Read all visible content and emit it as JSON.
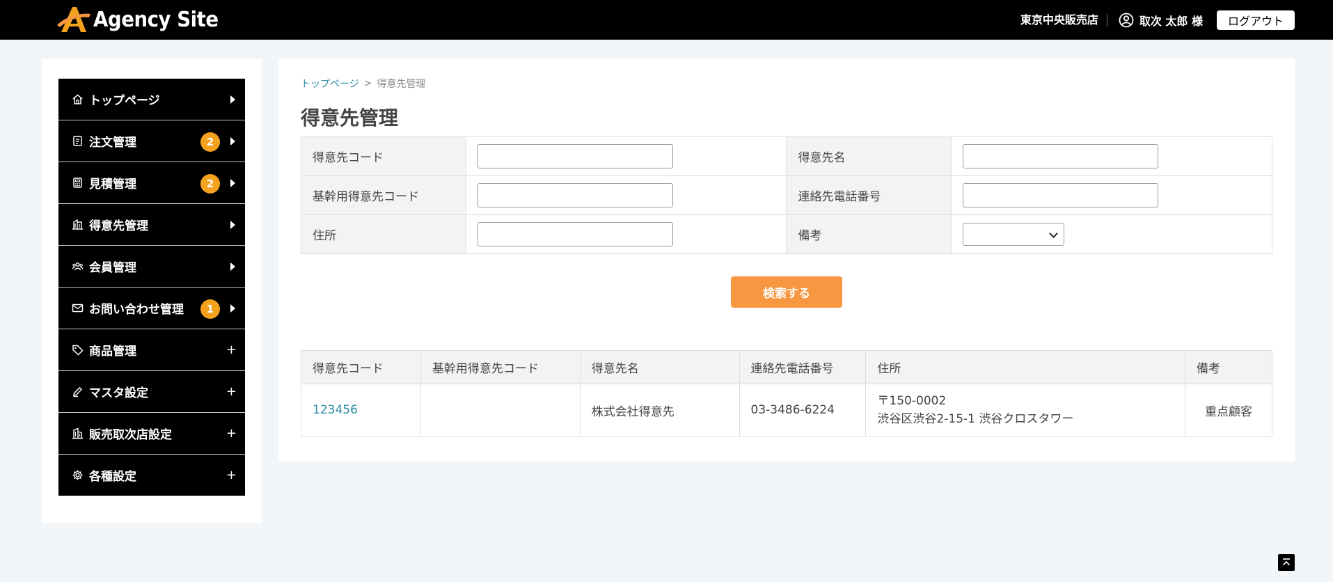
{
  "header": {
    "logo_text": "Agency Site",
    "shop_name": "東京中央販売店",
    "user_name": "取次 太郎 様",
    "logout_label": "ログアウト"
  },
  "sidebar": {
    "items": [
      {
        "label": "トップページ",
        "icon": "home-icon",
        "badge": null,
        "indicator": "arrow"
      },
      {
        "label": "注文管理",
        "icon": "document-icon",
        "badge": "2",
        "indicator": "arrow"
      },
      {
        "label": "見積管理",
        "icon": "calculator-icon",
        "badge": "2",
        "indicator": "arrow"
      },
      {
        "label": "得意先管理",
        "icon": "building-icon",
        "badge": null,
        "indicator": "arrow"
      },
      {
        "label": "会員管理",
        "icon": "users-icon",
        "badge": null,
        "indicator": "arrow"
      },
      {
        "label": "お問い合わせ管理",
        "icon": "mail-icon",
        "badge": "1",
        "indicator": "arrow"
      },
      {
        "label": "商品管理",
        "icon": "tag-icon",
        "badge": null,
        "indicator": "plus"
      },
      {
        "label": "マスタ設定",
        "icon": "pencil-icon",
        "badge": null,
        "indicator": "plus"
      },
      {
        "label": "販売取次店設定",
        "icon": "office-icon",
        "badge": null,
        "indicator": "plus"
      },
      {
        "label": "各種設定",
        "icon": "gear-icon",
        "badge": null,
        "indicator": "plus"
      }
    ],
    "plus_glyph": "+"
  },
  "breadcrumb": {
    "home": "トップページ",
    "separator": ">",
    "current": "得意先管理"
  },
  "page_title": "得意先管理",
  "search_form": {
    "customer_code_label": "得意先コード",
    "customer_name_label": "得意先名",
    "core_code_label": "基幹用得意先コード",
    "phone_label": "連絡先電話番号",
    "address_label": "住所",
    "remarks_label": "備考",
    "remarks_selected": ""
  },
  "search_button": "検索する",
  "results": {
    "columns": [
      "得意先コード",
      "基幹用得意先コード",
      "得意先名",
      "連絡先電話番号",
      "住所",
      "備考"
    ],
    "rows": [
      {
        "code": "123456",
        "core_code": "",
        "name": "株式会社得意先",
        "phone": "03-3486-6224",
        "address_line1": "〒150-0002",
        "address_line2": "渋谷区渋谷2-15-1 渋谷クロスタワー",
        "remarks": "重点顧客"
      }
    ]
  },
  "colors": {
    "header_bg": "#000000",
    "accent_orange": "#f79741",
    "badge_orange": "#f4a11e",
    "link_teal": "#2a8ca7"
  }
}
